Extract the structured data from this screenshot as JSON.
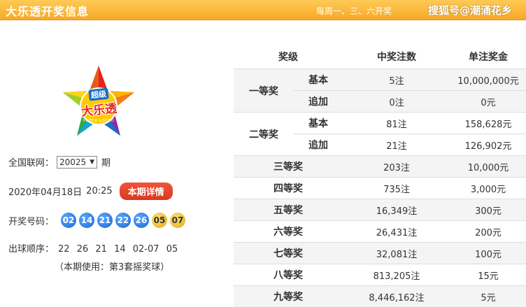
{
  "header": {
    "title": "大乐透开奖信息",
    "schedule": "每周一、三、六开奖",
    "watermark": "搜狐号@潮涌花乡"
  },
  "logo": {
    "small": "超级",
    "main": "大乐透",
    "sub": "SUPER LOTTO"
  },
  "issue": {
    "label": "全国联网：",
    "selected": "20025",
    "suffix": "期"
  },
  "draw": {
    "date": "2020年04月18日",
    "time": "20:25",
    "detail_button": "本期详情"
  },
  "numbers": {
    "label": "开奖号码：",
    "front": [
      "02",
      "14",
      "21",
      "22",
      "26"
    ],
    "back": [
      "05",
      "07"
    ]
  },
  "order": {
    "label": "出球顺序：",
    "front": [
      "22",
      "26",
      "21",
      "14",
      "02-07",
      "05"
    ],
    "note": "（本期使用：第3套摇奖球）"
  },
  "table": {
    "headers": [
      "奖级",
      "中奖注数",
      "单注奖金"
    ],
    "rows": [
      {
        "level": "一等奖",
        "sub": "基本",
        "count": "5注",
        "prize": "10,000,000元"
      },
      {
        "level": "",
        "sub": "追加",
        "count": "0注",
        "prize": "0元"
      },
      {
        "level": "二等奖",
        "sub": "基本",
        "count": "81注",
        "prize": "158,628元"
      },
      {
        "level": "",
        "sub": "追加",
        "count": "21注",
        "prize": "126,902元"
      },
      {
        "level": "三等奖",
        "sub": "",
        "count": "203注",
        "prize": "10,000元"
      },
      {
        "level": "四等奖",
        "sub": "",
        "count": "735注",
        "prize": "3,000元"
      },
      {
        "level": "五等奖",
        "sub": "",
        "count": "16,349注",
        "prize": "300元"
      },
      {
        "level": "六等奖",
        "sub": "",
        "count": "26,431注",
        "prize": "200元"
      },
      {
        "level": "七等奖",
        "sub": "",
        "count": "32,081注",
        "prize": "100元"
      },
      {
        "level": "八等奖",
        "sub": "",
        "count": "813,205注",
        "prize": "15元"
      },
      {
        "level": "九等奖",
        "sub": "",
        "count": "8,446,162注",
        "prize": "5元"
      }
    ]
  },
  "colors": {
    "header": "#f7a928",
    "ball_front": "#1a66d6",
    "ball_back": "#e2a70c",
    "detail_button": "#d83a1f"
  }
}
